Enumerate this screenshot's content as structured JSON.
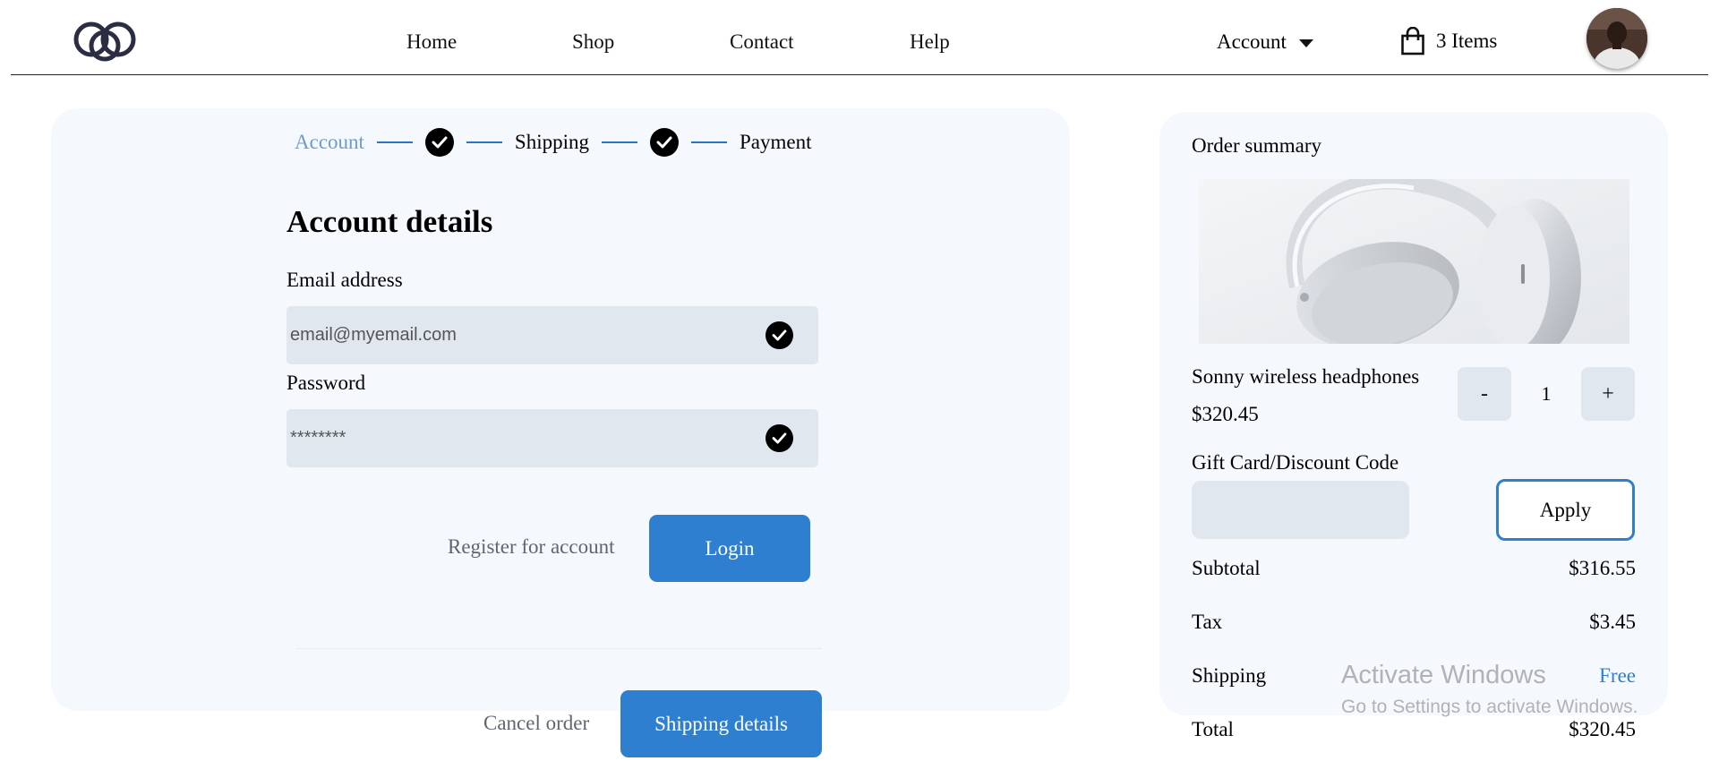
{
  "header": {
    "nav": [
      "Home",
      "Shop",
      "Contact",
      "Help"
    ],
    "account_label": "Account",
    "cart_label": "3 Items"
  },
  "stepper": {
    "steps": [
      "Account",
      "Shipping",
      "Payment"
    ]
  },
  "account_form": {
    "title": "Account details",
    "email_label": "Email address",
    "email_value": "email@myemail.com",
    "password_label": "Password",
    "password_value": "********",
    "register_label": "Register for account",
    "login_label": "Login",
    "cancel_label": "Cancel order",
    "next_label": "Shipping details"
  },
  "order_summary": {
    "title": "Order summary",
    "product_name": "Sonny wireless headphones",
    "product_price": "$320.45",
    "qty_minus": "-",
    "qty_value": "1",
    "qty_plus": "+",
    "discount_label": "Gift Card/Discount Code",
    "discount_value": "",
    "apply_label": "Apply",
    "subtotal_label": "Subtotal",
    "subtotal_value": "$316.55",
    "tax_label": "Tax",
    "tax_value": "$3.45",
    "shipping_label": "Shipping",
    "shipping_value": "Free",
    "total_label": "Total",
    "total_value": "$320.45"
  },
  "watermark": {
    "title": "Activate Windows",
    "subtitle": "Go to Settings to activate Windows."
  },
  "colors": {
    "accent": "#2f7fd0",
    "card_bg": "#f5f8fc",
    "field_bg": "#e1e7ef",
    "step_inactive": "#6a9ed2"
  }
}
